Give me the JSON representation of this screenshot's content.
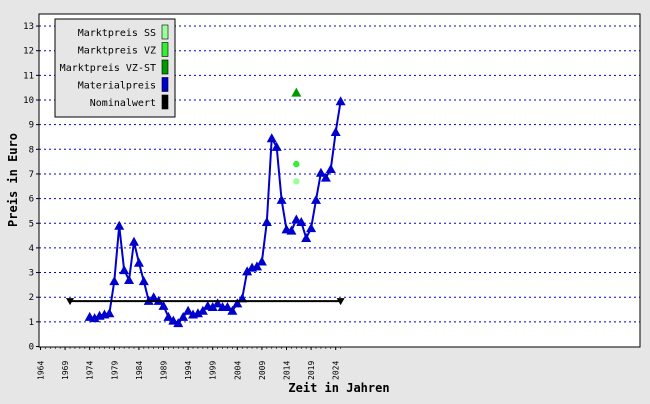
{
  "chart_data": {
    "type": "line",
    "title": "",
    "xlabel": "Zeit in Jahren",
    "ylabel": "Preis in Euro",
    "xlim": [
      1964,
      2025
    ],
    "ylim": [
      0,
      13.5
    ],
    "x_ticks": [
      1964,
      1969,
      1974,
      1979,
      1984,
      1989,
      1994,
      1999,
      2004,
      2009,
      2014,
      2019,
      2024
    ],
    "y_ticks": [
      0,
      1,
      2,
      3,
      4,
      5,
      6,
      7,
      8,
      9,
      10,
      11,
      12,
      13
    ],
    "grid": "horizontal dotted",
    "legend_position": "top-left",
    "legend": [
      {
        "label": "Marktpreis SS",
        "color": "#99ff99"
      },
      {
        "label": "Marktpreis VZ",
        "color": "#33ee33"
      },
      {
        "label": "Marktpreis VZ-ST",
        "color": "#009900"
      },
      {
        "label": "Materialpreis",
        "color": "#0000cc"
      },
      {
        "label": "Nominalwert",
        "color": "#000000"
      }
    ],
    "series": [
      {
        "name": "Materialpreis",
        "color": "#0000cc",
        "marker": "triangle",
        "x": [
          1974,
          1975,
          1976,
          1977,
          1978,
          1979,
          1980,
          1981,
          1982,
          1983,
          1984,
          1985,
          1986,
          1987,
          1988,
          1989,
          1990,
          1991,
          1992,
          1993,
          1994,
          1995,
          1996,
          1997,
          1998,
          1999,
          2000,
          2001,
          2002,
          2003,
          2004,
          2005,
          2006,
          2007,
          2008,
          2009,
          2010,
          2011,
          2012,
          2013,
          2014,
          2015,
          2016,
          2017,
          2018,
          2019,
          2020,
          2021,
          2022,
          2023,
          2024,
          2025
        ],
        "y": [
          1.2,
          1.15,
          1.25,
          1.3,
          1.35,
          2.65,
          4.9,
          3.1,
          2.7,
          4.25,
          3.4,
          2.65,
          1.85,
          2.0,
          1.85,
          1.65,
          1.2,
          1.05,
          0.95,
          1.2,
          1.45,
          1.3,
          1.35,
          1.45,
          1.65,
          1.6,
          1.75,
          1.6,
          1.6,
          1.45,
          1.75,
          1.95,
          3.05,
          3.2,
          3.25,
          3.45,
          5.05,
          8.45,
          8.1,
          5.95,
          4.75,
          4.7,
          5.15,
          5.05,
          4.4,
          4.8,
          5.95,
          7.05,
          6.85,
          7.2,
          8.7,
          9.95
        ]
      },
      {
        "name": "Nominalwert",
        "color": "#000000",
        "marker": "triangle-down",
        "x": [
          1970,
          2025
        ],
        "y": [
          1.84,
          1.84
        ]
      },
      {
        "name": "Marktpreis SS",
        "color": "#99ff99",
        "marker": "circle",
        "x": [
          2016
        ],
        "y": [
          6.7
        ]
      },
      {
        "name": "Marktpreis VZ",
        "color": "#33ee33",
        "marker": "circle",
        "x": [
          2016
        ],
        "y": [
          7.4
        ]
      },
      {
        "name": "Marktpreis VZ-ST",
        "color": "#009900",
        "marker": "triangle",
        "x": [
          2016
        ],
        "y": [
          10.3
        ]
      }
    ]
  }
}
